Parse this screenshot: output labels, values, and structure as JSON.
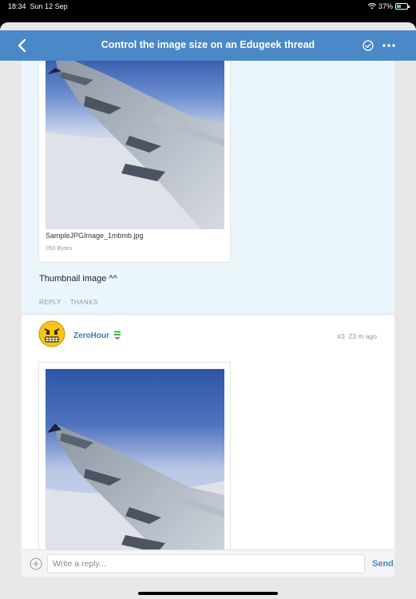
{
  "status_bar": {
    "time": "18:34",
    "date": "Sun 12 Sep",
    "battery": "37%",
    "icons": [
      "wifi-icon",
      "battery-icon"
    ]
  },
  "nav": {
    "title": "Control the image size on an Edugeek thread",
    "back_icon": "chevron-left-icon",
    "check_icon": "check-circle-icon",
    "more_icon": "more-icon",
    "bar_color": "#4a88c7"
  },
  "posts": [
    {
      "attachment": {
        "file_name": "SampleJPGImage_1mbmb.jpg",
        "file_size": "350 Bytes",
        "image": "airplane-wing-photo"
      },
      "text": "Thumbnail image ^^",
      "actions": [
        "REPLY",
        "·",
        "THANKS"
      ],
      "background": "#eaf5fc"
    },
    {
      "username": "ZeroHour",
      "avatar": "angry-emoji-avatar",
      "badge_icon": "rank-badge-icon",
      "post_number": "#3",
      "time_ago": "23 m ago",
      "attachment": {
        "image": "airplane-wing-photo"
      }
    }
  ],
  "reply_bar": {
    "plus_icon": "plus-circle-icon",
    "placeholder": "Write a reply...",
    "send_label": "Send"
  },
  "colors": {
    "accent": "#4a88c7",
    "username": "#3a7ab5",
    "muted": "#8a9aa6"
  }
}
